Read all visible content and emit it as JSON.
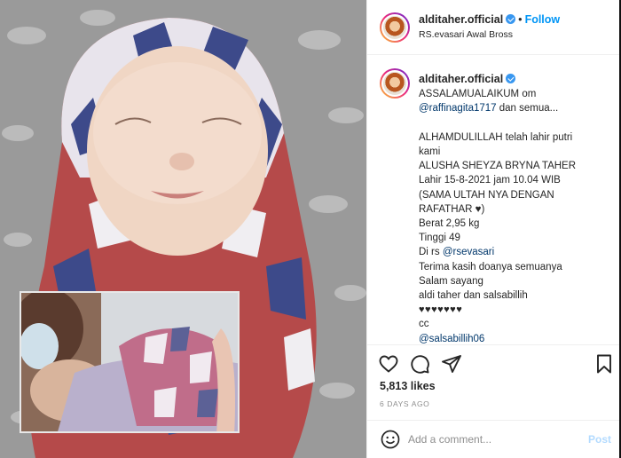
{
  "header": {
    "username": "alditaher.official",
    "follow_label": "Follow",
    "location": "RS.evasari Awal Bross"
  },
  "caption": {
    "username": "alditaher.official",
    "greeting": "ASSALAMUALAIKUM om",
    "mention_1": "@raffinagita1717",
    "after_mention_1": " dan semua...",
    "line_1": "ALHAMDULILLAH telah lahir putri",
    "line_2": "kami",
    "line_3": "ALUSHA SHEYZA BRYNA TAHER",
    "line_4": "Lahir 15-8-2021 jam 10.04 WIB",
    "line_5": "(SAMA ULTAH NYA DENGAN",
    "line_6": "RAFATHAR ♥)",
    "line_7": "Berat 2,95 kg",
    "line_8": "Tinggi 49",
    "di_rs": "Di rs ",
    "mention_2": "@rsevasari",
    "line_9": "Terima kasih doanya semuanya",
    "line_10": "Salam sayang",
    "line_11": "aldi taher dan salsabillih",
    "hearts": "♥♥♥♥♥♥♥",
    "cc": "cc",
    "mention_3": "@salsabillih06"
  },
  "actions": {
    "icons": [
      "heart-icon",
      "comment-icon",
      "share-icon",
      "bookmark-icon"
    ],
    "likes": "5,813 likes",
    "time": "6 DAYS AGO"
  },
  "comment": {
    "placeholder": "Add a comment...",
    "post_label": "Post"
  },
  "colors": {
    "accent": "#0095f6",
    "mention": "#00376b",
    "muted": "#8e8e8e",
    "post_disabled": "#b3dbff",
    "verified": "#3897f0"
  }
}
